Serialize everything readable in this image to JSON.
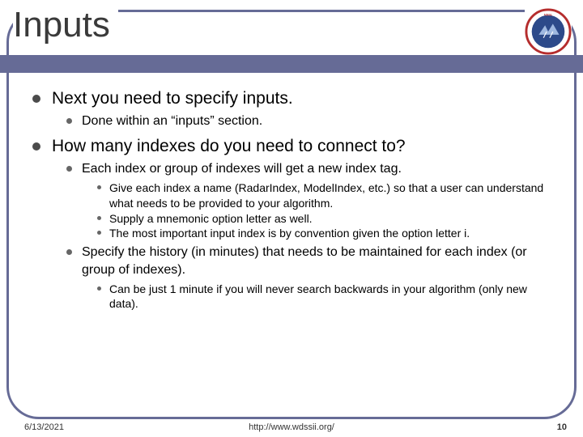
{
  "title": "Inputs",
  "items": [
    {
      "text": "Next you need to specify inputs.",
      "children": [
        {
          "text": "Done within an “inputs” section."
        }
      ]
    },
    {
      "text": "How many indexes do you need to connect to?",
      "children": [
        {
          "text": "Each index or group of indexes will get a new index tag.",
          "children": [
            {
              "text": "Give each index a name (RadarIndex, ModelIndex, etc.) so that a user can understand what needs to be provided to your algorithm."
            },
            {
              "text": "Supply a mnemonic option letter as well."
            },
            {
              "text": "The most important input index is by convention given the option letter i."
            }
          ]
        },
        {
          "text": "Specify the history (in minutes) that needs to be maintained for each index (or group of indexes).",
          "children": [
            {
              "text": "Can be just 1 minute if you will never search backwards in your algorithm (only new data)."
            }
          ]
        }
      ]
    }
  ],
  "footer": {
    "date": "6/13/2021",
    "url": "http://www.wdssii.org/",
    "page": "10"
  },
  "colors": {
    "accent": "#666b96",
    "logo_ring": "#b52d2d",
    "logo_fill": "#2d4a8a"
  }
}
